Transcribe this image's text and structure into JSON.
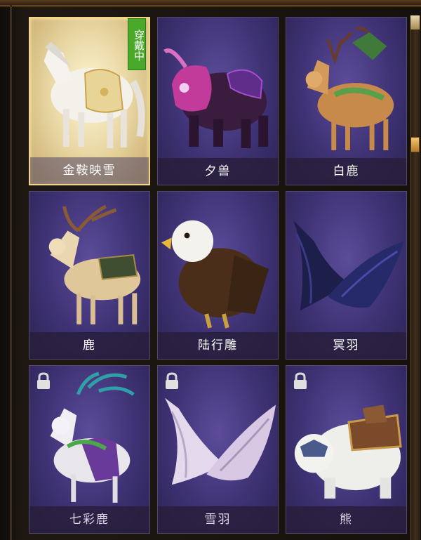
{
  "mounts": [
    {
      "name": "金鞍映雪",
      "state": "selected",
      "badge": "穿戴中"
    },
    {
      "name": "夕兽",
      "state": "owned"
    },
    {
      "name": "白鹿",
      "state": "owned"
    },
    {
      "name": "鹿",
      "state": "owned"
    },
    {
      "name": "陆行雕",
      "state": "owned"
    },
    {
      "name": "冥羽",
      "state": "owned"
    },
    {
      "name": "七彩鹿",
      "state": "locked"
    },
    {
      "name": "雪羽",
      "state": "locked"
    },
    {
      "name": "熊",
      "state": "locked"
    }
  ],
  "icons": {
    "lock": "lock-icon"
  },
  "colors": {
    "badge": "#4aa82a",
    "selected_border": "#f0d48a",
    "card_bg": "#3e3274",
    "scroll_thumb": "#f4c870"
  }
}
